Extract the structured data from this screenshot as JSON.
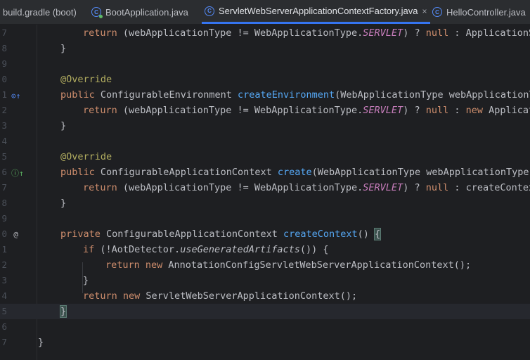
{
  "tabs": [
    {
      "label": "build.gradle (boot)",
      "icon": "gradle-icon",
      "active": false
    },
    {
      "label": "BootApplication.java",
      "icon": "spring-class-icon",
      "active": false
    },
    {
      "label": "ServletWebServerApplicationContextFactory.java",
      "icon": "class-icon",
      "active": true,
      "close": "×"
    },
    {
      "label": "HelloController.java",
      "icon": "class-icon",
      "active": false
    }
  ],
  "gutter_icons": {
    "override_a": "⊙↑",
    "override_b": "ⓘ↑",
    "at": "@"
  },
  "lines": [
    {
      "n": "7",
      "tokens": [
        [
          "kw",
          "return"
        ],
        [
          "",
          "(webApplicationType != WebApplicationType."
        ],
        [
          "it",
          "SERVLET"
        ],
        [
          "",
          ") ? "
        ],
        [
          "kw",
          "null"
        ],
        [
          "",
          ": ApplicationSe"
        ]
      ]
    },
    {
      "n": "8",
      "tokens": [
        [
          "",
          "}"
        ]
      ]
    },
    {
      "n": "9",
      "tokens": []
    },
    {
      "n": "0",
      "tokens": [
        [
          "ann",
          "@Override"
        ]
      ]
    },
    {
      "n": "1",
      "tokens": [
        [
          "kw",
          "public "
        ],
        [
          "",
          "ConfigurableEnvironment "
        ],
        [
          "fn",
          "createEnvironment"
        ],
        [
          "",
          "(WebApplicationType webApplicationTy"
        ]
      ]
    },
    {
      "n": "2",
      "tokens": [
        [
          "kw",
          "return"
        ],
        [
          "",
          "(webApplicationType != WebApplicationType."
        ],
        [
          "it",
          "SERVLET"
        ],
        [
          "",
          ") ? "
        ],
        [
          "kw",
          "null"
        ],
        [
          "",
          ": "
        ],
        [
          "kw",
          "new "
        ],
        [
          "",
          "Applicati"
        ]
      ]
    },
    {
      "n": "3",
      "tokens": [
        [
          "",
          "}"
        ]
      ]
    },
    {
      "n": "4",
      "tokens": []
    },
    {
      "n": "5",
      "tokens": [
        [
          "ann",
          "@Override"
        ]
      ]
    },
    {
      "n": "6",
      "tokens": [
        [
          "kw",
          "public "
        ],
        [
          "",
          "ConfigurableApplicationContext "
        ],
        [
          "fn",
          "create"
        ],
        [
          "",
          "(WebApplicationType webApplicationType)"
        ]
      ]
    },
    {
      "n": "7",
      "tokens": [
        [
          "kw",
          "return"
        ],
        [
          "",
          "(webApplicationType != WebApplicationType."
        ],
        [
          "it",
          "SERVLET"
        ],
        [
          "",
          ") ? "
        ],
        [
          "kw",
          "null"
        ],
        [
          "",
          ": createContext"
        ]
      ]
    },
    {
      "n": "8",
      "tokens": [
        [
          "",
          "}"
        ]
      ]
    },
    {
      "n": "9",
      "tokens": []
    },
    {
      "n": "0",
      "tokens": [
        [
          "kw",
          "private "
        ],
        [
          "",
          "ConfigurableApplicationContext "
        ],
        [
          "fn",
          "createContext"
        ],
        [
          "",
          "() "
        ],
        [
          "brace",
          "{"
        ]
      ]
    },
    {
      "n": "1",
      "tokens": [
        [
          "kw",
          "if "
        ],
        [
          "",
          "(!AotDetector."
        ],
        [
          "fi",
          "useGeneratedArtifacts"
        ],
        [
          "",
          "()) {"
        ]
      ]
    },
    {
      "n": "2",
      "tokens": [
        [
          "kw",
          "return "
        ],
        [
          "kw",
          "new "
        ],
        [
          "",
          "AnnotationConfigServletWebServerApplicationContext();"
        ]
      ]
    },
    {
      "n": "3",
      "tokens": [
        [
          "",
          "}"
        ]
      ]
    },
    {
      "n": "4",
      "tokens": [
        [
          "kw",
          "return "
        ],
        [
          "kw",
          "new "
        ],
        [
          "",
          "ServletWebServerApplicationContext();"
        ]
      ]
    },
    {
      "n": "5",
      "tokens": [
        [
          "brace",
          "}"
        ]
      ]
    },
    {
      "n": "6",
      "tokens": []
    },
    {
      "n": "7",
      "tokens": [
        [
          "",
          "}"
        ]
      ]
    }
  ]
}
